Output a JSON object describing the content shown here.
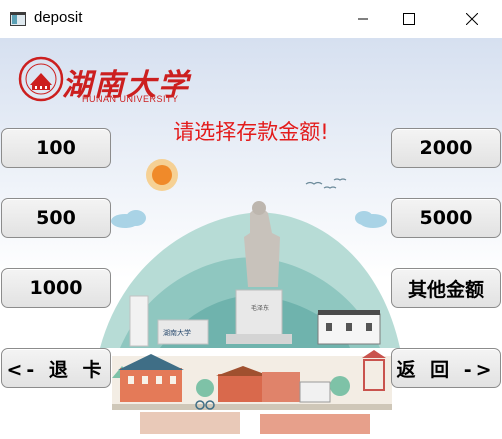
{
  "window": {
    "title": "deposit"
  },
  "logo": {
    "cn_text": "湖南大学",
    "en_text": "HUNAN UNIVERSITY"
  },
  "prompt": "请选择存款金额!",
  "amounts": {
    "left": [
      "100",
      "500",
      "1000"
    ],
    "right": [
      "2000",
      "5000",
      "其他金额"
    ]
  },
  "nav": {
    "back_label": "<- 退 卡",
    "return_label": "返 回 ->"
  },
  "colors": {
    "prompt": "#e31b1b",
    "logo": "#cc1f1f",
    "button_bg": "#e6e6e6",
    "sky": "#d6e0f0",
    "hill": "#8fc7c0"
  }
}
